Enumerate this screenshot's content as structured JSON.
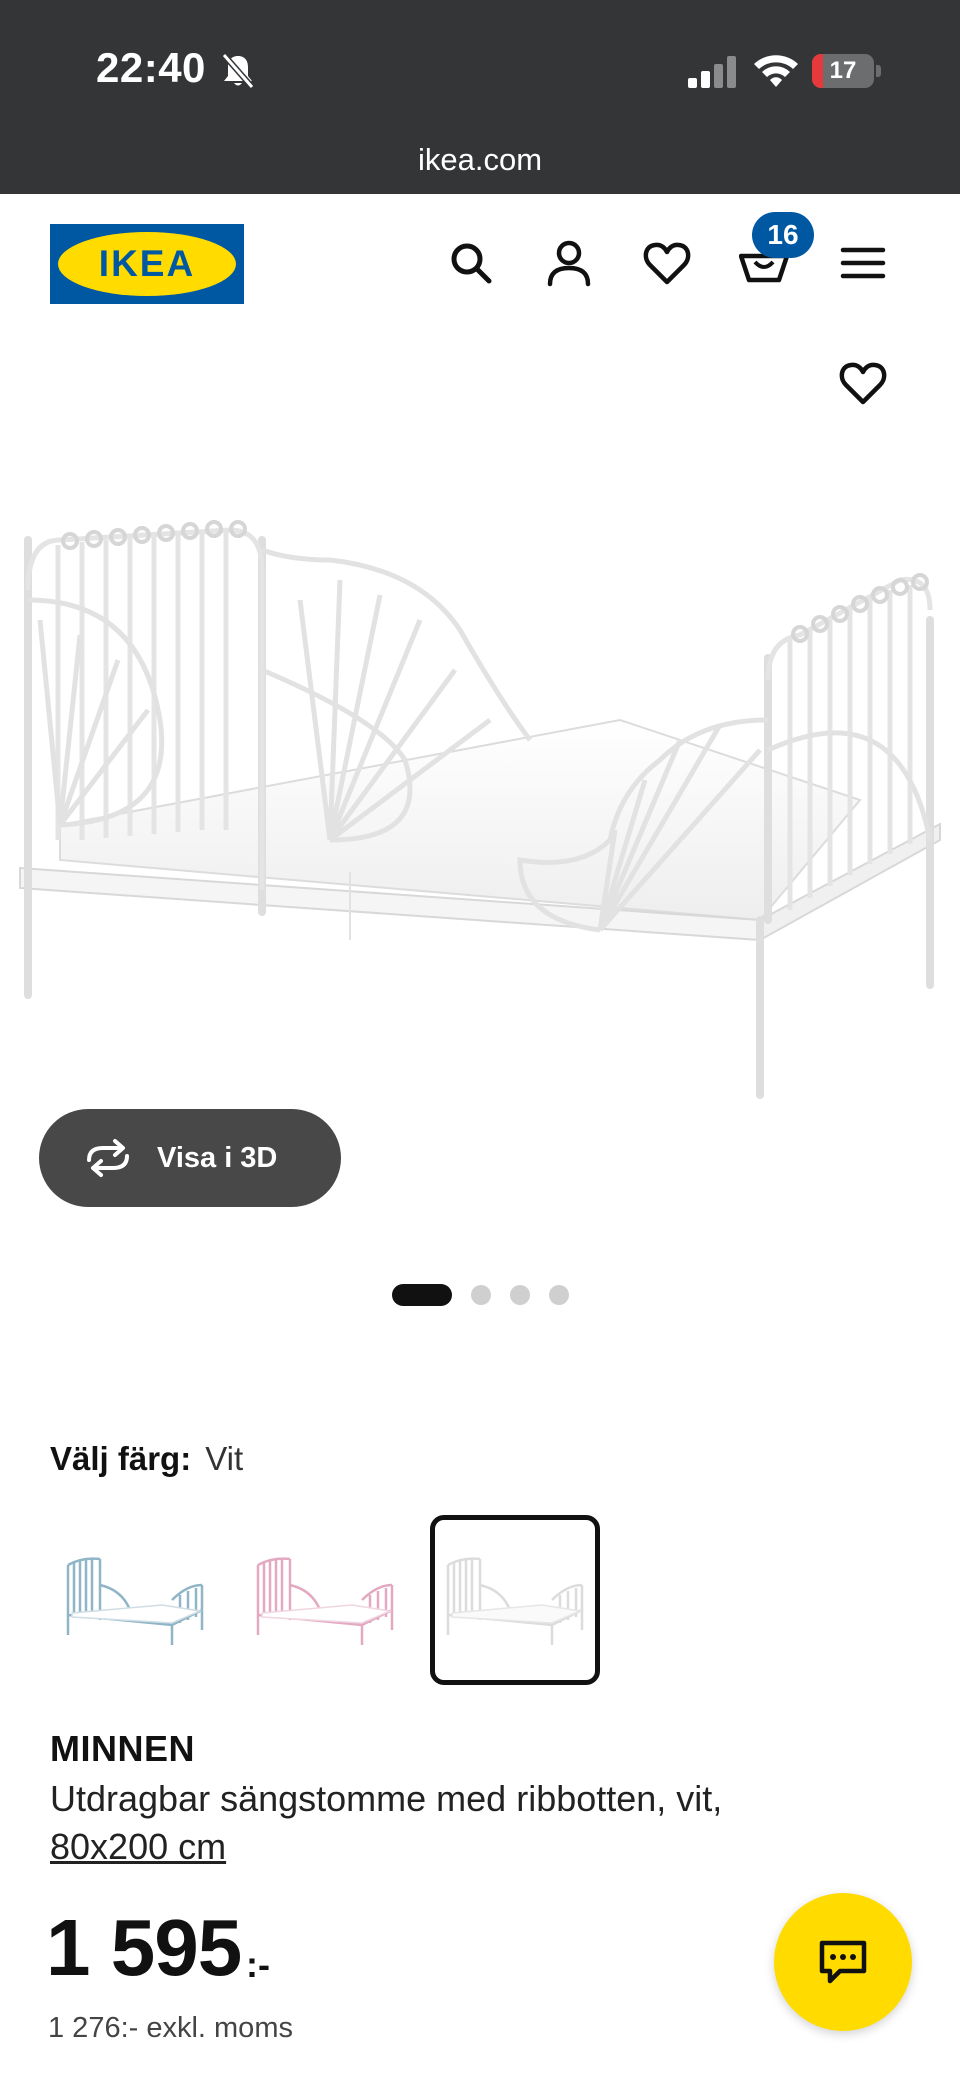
{
  "status_bar": {
    "time": "22:40",
    "battery_level": "17",
    "battery_fraction": 0.17
  },
  "browser": {
    "url": "ikea.com"
  },
  "header": {
    "logo_text": "IKEA",
    "cart_count": "16",
    "icons": [
      "search-icon",
      "account-icon",
      "wishlist-icon",
      "cart-icon",
      "menu-icon"
    ]
  },
  "gallery": {
    "view_3d_label": "Visa i 3D",
    "dot_count": 4,
    "active_dot": 0
  },
  "color_picker": {
    "label": "Välj färg:",
    "selected_value": "Vit",
    "swatches": [
      {
        "name": "Blå",
        "color": "#8fb5c7"
      },
      {
        "name": "Rosa",
        "color": "#e8b7cc"
      },
      {
        "name": "Vit",
        "color": "#e6e6e6"
      }
    ],
    "selected_index": 2
  },
  "product": {
    "name": "MINNEN",
    "description": "Utdragbar sängstomme med ribbotten, vit,",
    "size_link": "80x200 cm",
    "price": "1 595",
    "price_suffix": ":-",
    "price_ex_vat": "1 276:- exkl. moms"
  },
  "colors": {
    "ikea_blue": "#0058a3",
    "ikea_yellow": "#ffdb00",
    "status_bar_bg": "#333537"
  }
}
